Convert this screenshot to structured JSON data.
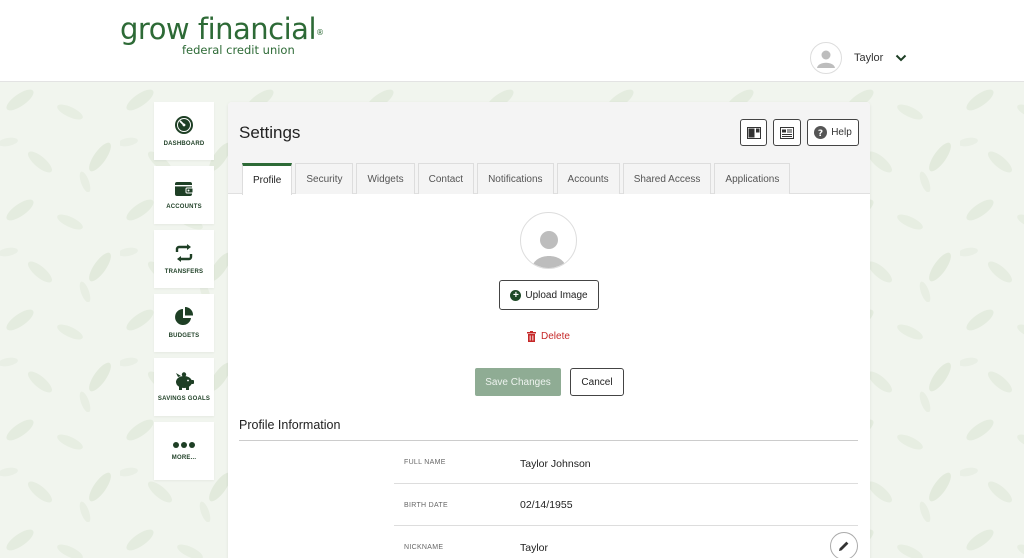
{
  "brand": {
    "name": "grow financial",
    "trademark": "®",
    "tagline": "federal credit union",
    "primary_color": "#2d6a36",
    "dark_green": "#1e3f25",
    "danger_color": "#c62828"
  },
  "user": {
    "name": "Taylor",
    "avatar_icon": "user-silhouette-icon",
    "menu_icon": "chevron-down-icon"
  },
  "sidebar": {
    "items": [
      {
        "label": "DASHBOARD",
        "icon": "gauge-icon"
      },
      {
        "label": "ACCOUNTS",
        "icon": "wallet-icon"
      },
      {
        "label": "TRANSFERS",
        "icon": "transfer-arrows-icon"
      },
      {
        "label": "BUDGETS",
        "icon": "pie-chart-icon"
      },
      {
        "label": "SAVINGS GOALS",
        "icon": "piggy-bank-icon"
      },
      {
        "label": "MORE...",
        "icon": "ellipsis-icon"
      }
    ]
  },
  "settings": {
    "title": "Settings",
    "help_label": "Help",
    "tabs": [
      {
        "label": "Profile",
        "active": true
      },
      {
        "label": "Security"
      },
      {
        "label": "Widgets"
      },
      {
        "label": "Contact"
      },
      {
        "label": "Notifications"
      },
      {
        "label": "Accounts"
      },
      {
        "label": "Shared Access"
      },
      {
        "label": "Applications"
      }
    ],
    "upload_label": "Upload Image",
    "delete_label": "Delete",
    "save_label": "Save Changes",
    "cancel_label": "Cancel",
    "profile_section_title": "Profile Information",
    "profile_fields": [
      {
        "label": "FULL NAME",
        "value": "Taylor Johnson"
      },
      {
        "label": "BIRTH DATE",
        "value": "02/14/1955"
      },
      {
        "label": "NICKNAME",
        "value": "Taylor"
      }
    ]
  }
}
